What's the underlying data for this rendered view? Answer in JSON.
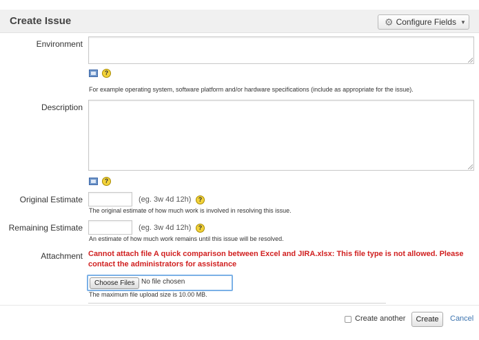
{
  "header": {
    "title": "Create Issue",
    "configure_label": "Configure Fields",
    "configure_icon": "gear-icon"
  },
  "fields": {
    "environment": {
      "label": "Environment",
      "help": "For example operating system, software platform and/or hardware specifications (include as appropriate for the issue)."
    },
    "description": {
      "label": "Description"
    },
    "original_estimate": {
      "label": "Original Estimate",
      "hint": "(eg. 3w 4d 12h)",
      "help": "The original estimate of how much work is involved in resolving this issue."
    },
    "remaining_estimate": {
      "label": "Remaining Estimate",
      "hint": "(eg. 3w 4d 12h)",
      "help": "An estimate of how much work remains until this issue will be resolved."
    },
    "attachment": {
      "label": "Attachment",
      "error": "Cannot attach file A quick comparison between Excel and JIRA.xlsx: This file type is not allowed. Please contact the administrators for assistance",
      "choose_label": "Choose Files",
      "no_file_text": "No file chosen",
      "max_size": "The maximum file upload size is 10.00 MB."
    }
  },
  "footer": {
    "create_another": "Create another",
    "create": "Create",
    "cancel": "Cancel"
  },
  "icons": {
    "help_glyph": "?"
  },
  "colors": {
    "error": "#d01f1f",
    "link": "#3b73af",
    "focus": "#7ab0e6",
    "help": "#f3d33a"
  }
}
